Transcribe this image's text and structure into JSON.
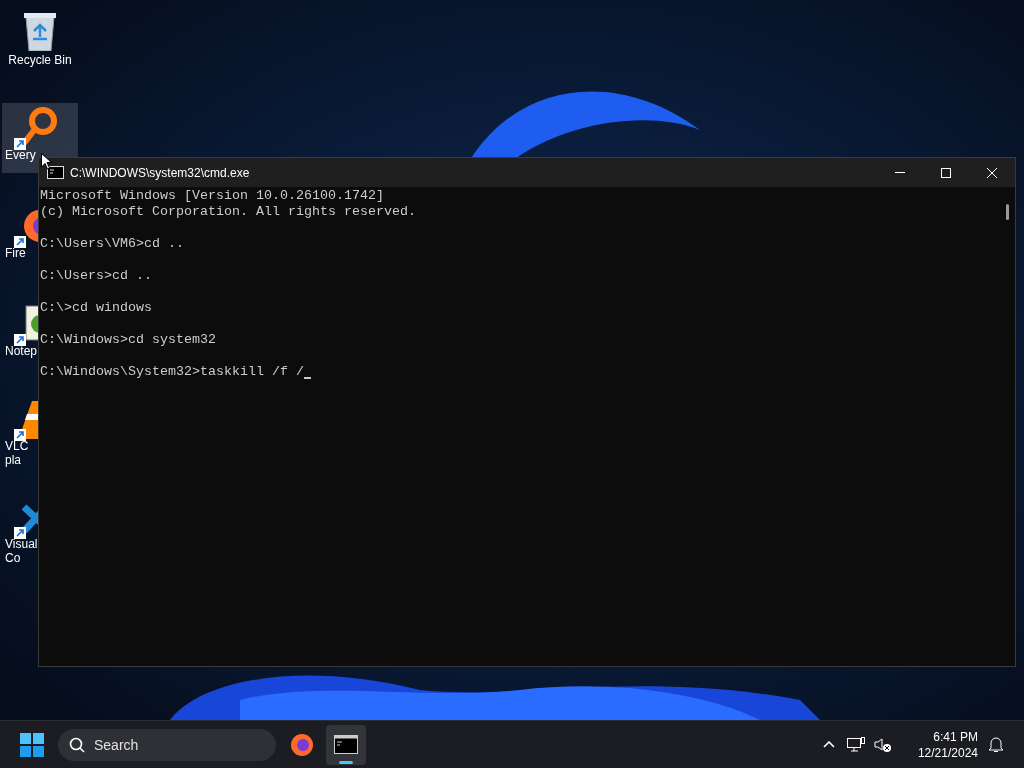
{
  "desktop_icons": [
    {
      "kind": "bin",
      "label_lines": [
        "Recycle Bin"
      ],
      "shortcut": false,
      "selected": false
    },
    {
      "kind": "magnifier",
      "label_lines": [
        "Every"
      ],
      "shortcut": true,
      "selected": true
    },
    {
      "kind": "browser",
      "label_lines": [
        "Fire"
      ],
      "shortcut": true,
      "selected": false
    },
    {
      "kind": "notepad",
      "label_lines": [
        "Notep"
      ],
      "shortcut": true,
      "selected": false
    },
    {
      "kind": "cone",
      "label_lines": [
        "VLC",
        "pla"
      ],
      "shortcut": true,
      "selected": false
    },
    {
      "kind": "code",
      "label_lines": [
        "Visual",
        "Co"
      ],
      "shortcut": true,
      "selected": false
    }
  ],
  "window": {
    "title": "C:\\WINDOWS\\system32\\cmd.exe",
    "blocks": [
      [
        "Microsoft Windows [Version 10.0.26100.1742]",
        "(c) Microsoft Corporation. All rights reserved."
      ],
      [
        "C:\\Users\\VM6>cd .."
      ],
      [
        "C:\\Users>cd .."
      ],
      [
        "C:\\>cd windows"
      ],
      [
        "C:\\Windows>cd system32"
      ],
      [
        "C:\\Windows\\System32>taskkill /f /"
      ]
    ]
  },
  "taskbar": {
    "search": {
      "placeholder": "Search"
    },
    "apps": [
      {
        "kind": "browser",
        "running": false
      },
      {
        "kind": "terminal",
        "running": true
      }
    ],
    "clock": {
      "time": "6:41 PM",
      "date": "12/21/2024"
    }
  }
}
